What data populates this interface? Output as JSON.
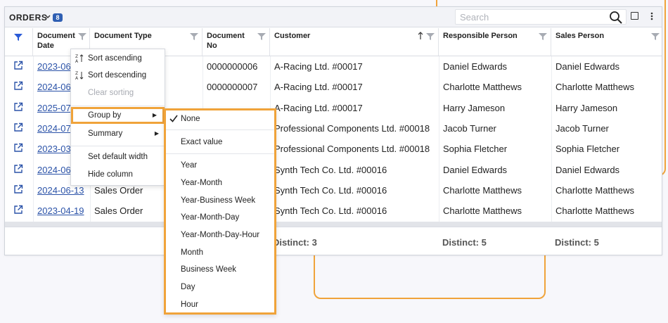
{
  "header": {
    "title": "ORDERS",
    "badge_count": "8",
    "search_placeholder": "Search"
  },
  "columns": [
    {
      "label": "Document Date"
    },
    {
      "label": "Document Type"
    },
    {
      "label": "Document No"
    },
    {
      "label": "Customer",
      "sort": "ascending"
    },
    {
      "label": "Responsible Person"
    },
    {
      "label": "Sales Person"
    }
  ],
  "rows": [
    {
      "date": "2023-06",
      "type": "",
      "doc_no": "0000000006",
      "customer": "A-Racing Ltd. #00017",
      "responsible": "Daniel Edwards",
      "sales": "Daniel Edwards"
    },
    {
      "date": "2024-06",
      "type": "",
      "doc_no": "0000000007",
      "customer": "A-Racing Ltd. #00017",
      "responsible": "Charlotte Matthews",
      "sales": "Charlotte Matthews"
    },
    {
      "date": "2025-07",
      "type": "",
      "doc_no": "",
      "customer": "A-Racing Ltd. #00017",
      "responsible": "Harry Jameson",
      "sales": "Harry Jameson"
    },
    {
      "date": "2024-07",
      "type": "",
      "doc_no": "",
      "customer": "Professional Components Ltd. #00018",
      "responsible": "Jacob Turner",
      "sales": "Jacob Turner"
    },
    {
      "date": "2023-03",
      "type": "",
      "doc_no": "",
      "customer": "Professional Components Ltd. #00018",
      "responsible": "Sophia Fletcher",
      "sales": "Sophia Fletcher"
    },
    {
      "date": "2024-06",
      "type": "",
      "doc_no": "",
      "customer": "Synth Tech Co. Ltd. #00016",
      "responsible": "Daniel Edwards",
      "sales": "Daniel Edwards"
    },
    {
      "date": "2024-06-13",
      "type": "Sales Order",
      "doc_no": "",
      "customer": "Synth Tech Co. Ltd. #00016",
      "responsible": "Charlotte Matthews",
      "sales": "Charlotte Matthews"
    },
    {
      "date": "2023-04-19",
      "type": "Sales Order",
      "doc_no": "",
      "customer": "Synth Tech Co. Ltd. #00016",
      "responsible": "Charlotte Matthews",
      "sales": "Charlotte Matthews"
    }
  ],
  "summary": {
    "customer": "Distinct: 3",
    "responsible": "Distinct: 5",
    "sales": "Distinct: 5"
  },
  "column_menu": {
    "sort_ascending": "Sort ascending",
    "sort_descending": "Sort descending",
    "clear_sorting": "Clear sorting",
    "group_by": "Group by",
    "summary": "Summary",
    "set_default_width": "Set default width",
    "hide_column": "Hide column"
  },
  "group_by_menu": {
    "selected": "None",
    "items": [
      "None",
      "Exact value",
      "Year",
      "Year-Month",
      "Year-Business Week",
      "Year-Month-Day",
      "Year-Month-Day-Hour",
      "Month",
      "Business Week",
      "Day",
      "Hour"
    ]
  },
  "colors": {
    "accent": "#2a52a8",
    "highlight": "#f0a33a",
    "filter_active": "#2a5bd7"
  }
}
